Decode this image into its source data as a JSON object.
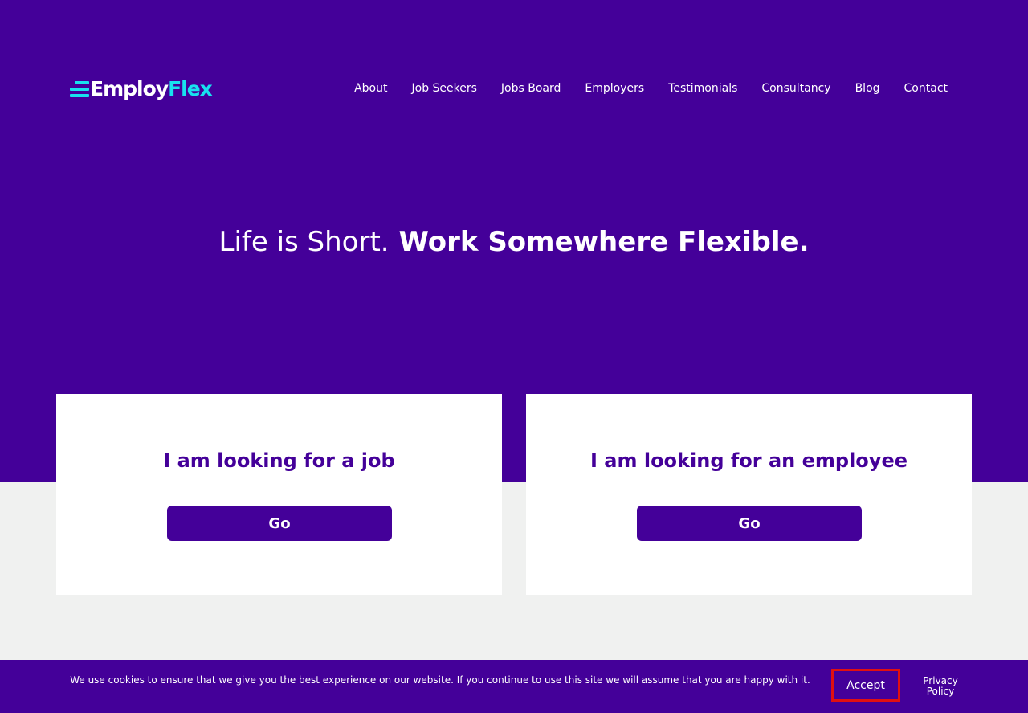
{
  "brand": {
    "logo_part1": "Employ",
    "logo_part2": "Flex",
    "primary_color": "#440099",
    "accent_color": "#18e2ef"
  },
  "nav": {
    "items": [
      {
        "label": "About"
      },
      {
        "label": "Job Seekers"
      },
      {
        "label": "Jobs Board"
      },
      {
        "label": "Employers"
      },
      {
        "label": "Testimonials"
      },
      {
        "label": "Consultancy"
      },
      {
        "label": "Blog"
      },
      {
        "label": "Contact"
      }
    ]
  },
  "hero": {
    "headline_light": "Life is Short.",
    "headline_strong": "Work Somewhere Flexible."
  },
  "cards": [
    {
      "title": "I am looking for a job",
      "button_label": "Go"
    },
    {
      "title": "I am looking for an employee",
      "button_label": "Go"
    }
  ],
  "cookie_notice": {
    "text": "We use cookies to ensure that we give you the best experience on our website. If you continue to use this site we will assume that you are happy with it.",
    "accept_label": "Accept",
    "privacy_label": "Privacy Policy"
  }
}
